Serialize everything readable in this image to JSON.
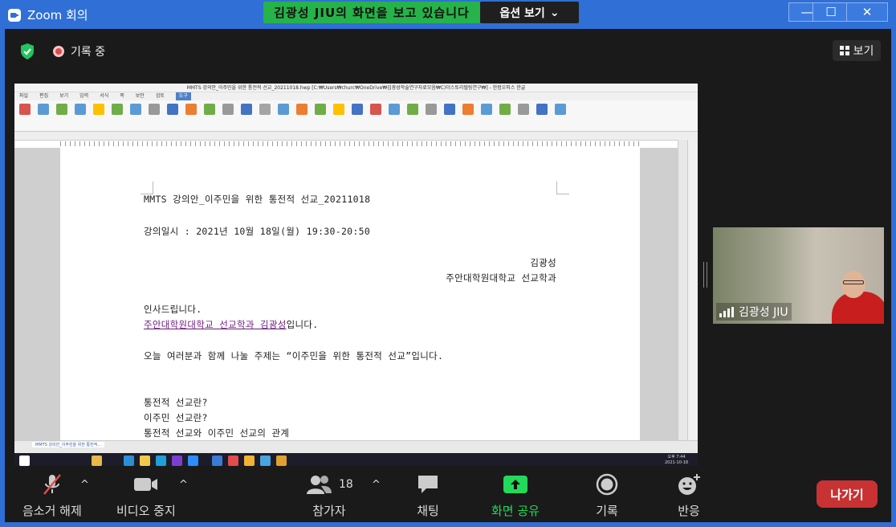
{
  "window": {
    "title": "Zoom 회의",
    "min": "—",
    "max": "☐",
    "close": "✕"
  },
  "banner": {
    "viewing": "김광성 JIU의 화면을 보고 있습니다",
    "options": "옵션 보기",
    "options_caret": "⌄"
  },
  "status": {
    "recording": "기록 중",
    "view": "보기"
  },
  "shared_screen": {
    "hwp_title": "MMTS 강의안_이주민을 위한 통전적 선교_20211018.hwp [C:₩Users₩churc₩OneDrive₩김광성학술연구자료모음₩C)더스토리텔링연구₩] - 한컴오피스 한글",
    "menu": [
      "파일",
      "편집",
      "보기",
      "입력",
      "서식",
      "쪽",
      "보안",
      "검토",
      "도구"
    ],
    "menu_active": "도구",
    "doc_lines": {
      "title": "MMTS 강의안_이주민을 위한 통전적 선교_20211018",
      "date": "강의일시 : 2021년 10월 18일(월) 19:30-20:50",
      "author": "김광성",
      "affiliation": "주안대학원대학교 선교학과",
      "greeting": "인사드립니다.",
      "intro_link": "주안대학원대학교 선교학과 김광성",
      "intro_suffix": "입니다.",
      "topic": "오늘 여러분과 함께 나눌 주제는 “이주민을 위한 통전적 선교”입니다.",
      "q1": "통전적 선교란?",
      "q2": "이주민 선교란?",
      "q3": "통전적 선교와 이주민 선교의 관계"
    },
    "doc_tab": "MMTS 강의안_이주민을 위한 통전적...",
    "taskbar_time": "오후 7:44",
    "taskbar_date": "2021-10-18"
  },
  "participant": {
    "name": "김광성 JIU"
  },
  "toolbar": {
    "unmute": "음소거 해제",
    "stop_video": "비디오 중지",
    "participants": "참가자",
    "participants_count": "18",
    "chat": "채팅",
    "share_screen": "화면 공유",
    "record": "기록",
    "reactions": "반응",
    "leave": "나가기",
    "caret": "^"
  },
  "colors": {
    "titlebar": "#2f6fd6",
    "banner": "#26b34a",
    "share_green": "#23d959",
    "leave_red": "#c83233"
  }
}
